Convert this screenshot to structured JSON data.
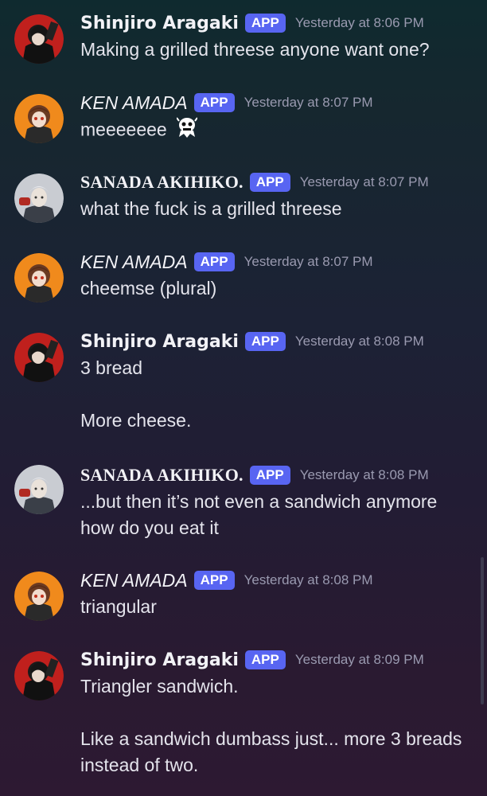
{
  "messages": [
    {
      "author": "Shinjiro Aragaki",
      "badge": "APP",
      "time": "Yesterday at 8:06 PM",
      "lines": [
        "Making a grilled threese anyone want one?"
      ]
    },
    {
      "author": "KEN AMADA",
      "badge": "APP",
      "time": "Yesterday at 8:07 PM",
      "lines": [
        "meeeeeee"
      ]
    },
    {
      "author": "SANADA AKIHIKO.",
      "badge": "APP",
      "time": "Yesterday at 8:07 PM",
      "lines": [
        "what the fuck is a grilled threese"
      ]
    },
    {
      "author": "KEN AMADA",
      "badge": "APP",
      "time": "Yesterday at 8:07 PM",
      "lines": [
        "cheemse (plural)"
      ]
    },
    {
      "author": "Shinjiro Aragaki",
      "badge": "APP",
      "time": "Yesterday at 8:08 PM",
      "lines": [
        "3 bread",
        "More cheese."
      ]
    },
    {
      "author": "SANADA AKIHIKO.",
      "badge": "APP",
      "time": "Yesterday at 8:08 PM",
      "lines": [
        "...but then it’s not even a sandwich anymore",
        "how do you eat it"
      ]
    },
    {
      "author": "KEN AMADA",
      "badge": "APP",
      "time": "Yesterday at 8:08 PM",
      "lines": [
        "triangular"
      ]
    },
    {
      "author": "Shinjiro Aragaki",
      "badge": "APP",
      "time": "Yesterday at 8:09 PM",
      "lines": [
        "Triangler sandwich.",
        "Like a sandwich dumbass just... more 3 breads",
        "instead of two."
      ]
    }
  ],
  "colors": {
    "badge": "#5865f2",
    "timestamp": "#9a9ab0",
    "text": "#e4e4ec"
  },
  "icons": {
    "emoji": "ghost-emoji-icon"
  }
}
